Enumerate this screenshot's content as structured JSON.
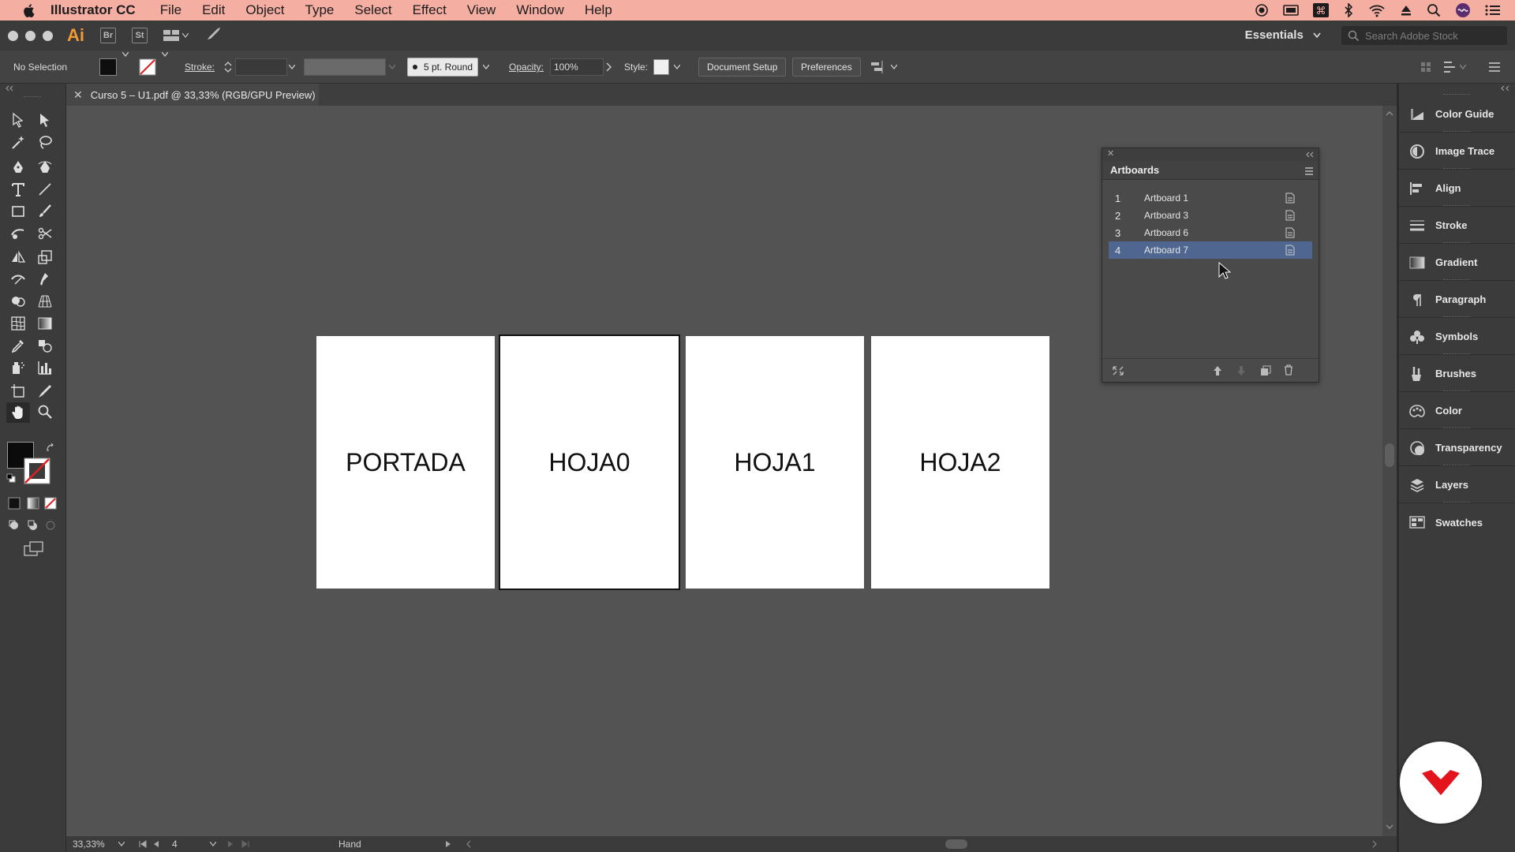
{
  "menubar": {
    "app_name": "Illustrator CC",
    "items": [
      "File",
      "Edit",
      "Object",
      "Type",
      "Select",
      "Effect",
      "View",
      "Window",
      "Help"
    ]
  },
  "appbar": {
    "logo": "Ai",
    "bridge_badge": "Br",
    "stock_badge": "St",
    "workspace": "Essentials",
    "search_placeholder": "Search Adobe Stock"
  },
  "control": {
    "selection": "No Selection",
    "stroke_label": "Stroke:",
    "brush": "5 pt. Round",
    "opacity_label": "Opacity:",
    "opacity_value": "100%",
    "style_label": "Style:",
    "document_setup": "Document Setup",
    "preferences": "Preferences"
  },
  "document": {
    "tab_title": "Curso 5 – U1.pdf @ 33,33% (RGB/GPU Preview)"
  },
  "artboards": [
    {
      "label": "PORTADA",
      "selected": false
    },
    {
      "label": "HOJA0",
      "selected": true
    },
    {
      "label": "HOJA1",
      "selected": false
    },
    {
      "label": "HOJA2",
      "selected": false
    }
  ],
  "artboards_panel": {
    "title": "Artboards",
    "rows": [
      {
        "num": "1",
        "name": "Artboard 1",
        "selected": false
      },
      {
        "num": "2",
        "name": "Artboard 3",
        "selected": false
      },
      {
        "num": "3",
        "name": "Artboard 6",
        "selected": false
      },
      {
        "num": "4",
        "name": "Artboard 7",
        "selected": true
      }
    ]
  },
  "dock": {
    "items": [
      {
        "label": "Color Guide",
        "icon": "color-guide-icon"
      },
      {
        "label": "Image Trace",
        "icon": "image-trace-icon"
      },
      {
        "label": "Align",
        "icon": "align-icon"
      },
      {
        "label": "Stroke",
        "icon": "stroke-icon"
      },
      {
        "label": "Gradient",
        "icon": "gradient-icon"
      },
      {
        "label": "Paragraph",
        "icon": "paragraph-icon"
      },
      {
        "label": "Symbols",
        "icon": "symbols-icon"
      },
      {
        "label": "Brushes",
        "icon": "brushes-icon"
      },
      {
        "label": "Color",
        "icon": "color-icon"
      },
      {
        "label": "Transparency",
        "icon": "transparency-icon"
      },
      {
        "label": "Layers",
        "icon": "layers-icon"
      },
      {
        "label": "Swatches",
        "icon": "swatches-icon"
      }
    ]
  },
  "status": {
    "zoom": "33,33%",
    "artboard_num": "4",
    "tool": "Hand"
  },
  "colors": {
    "menubar": "#f5aea2",
    "accent": "#f09a36",
    "selection_row": "#4f6790",
    "brand_logo": "#e3141b"
  }
}
